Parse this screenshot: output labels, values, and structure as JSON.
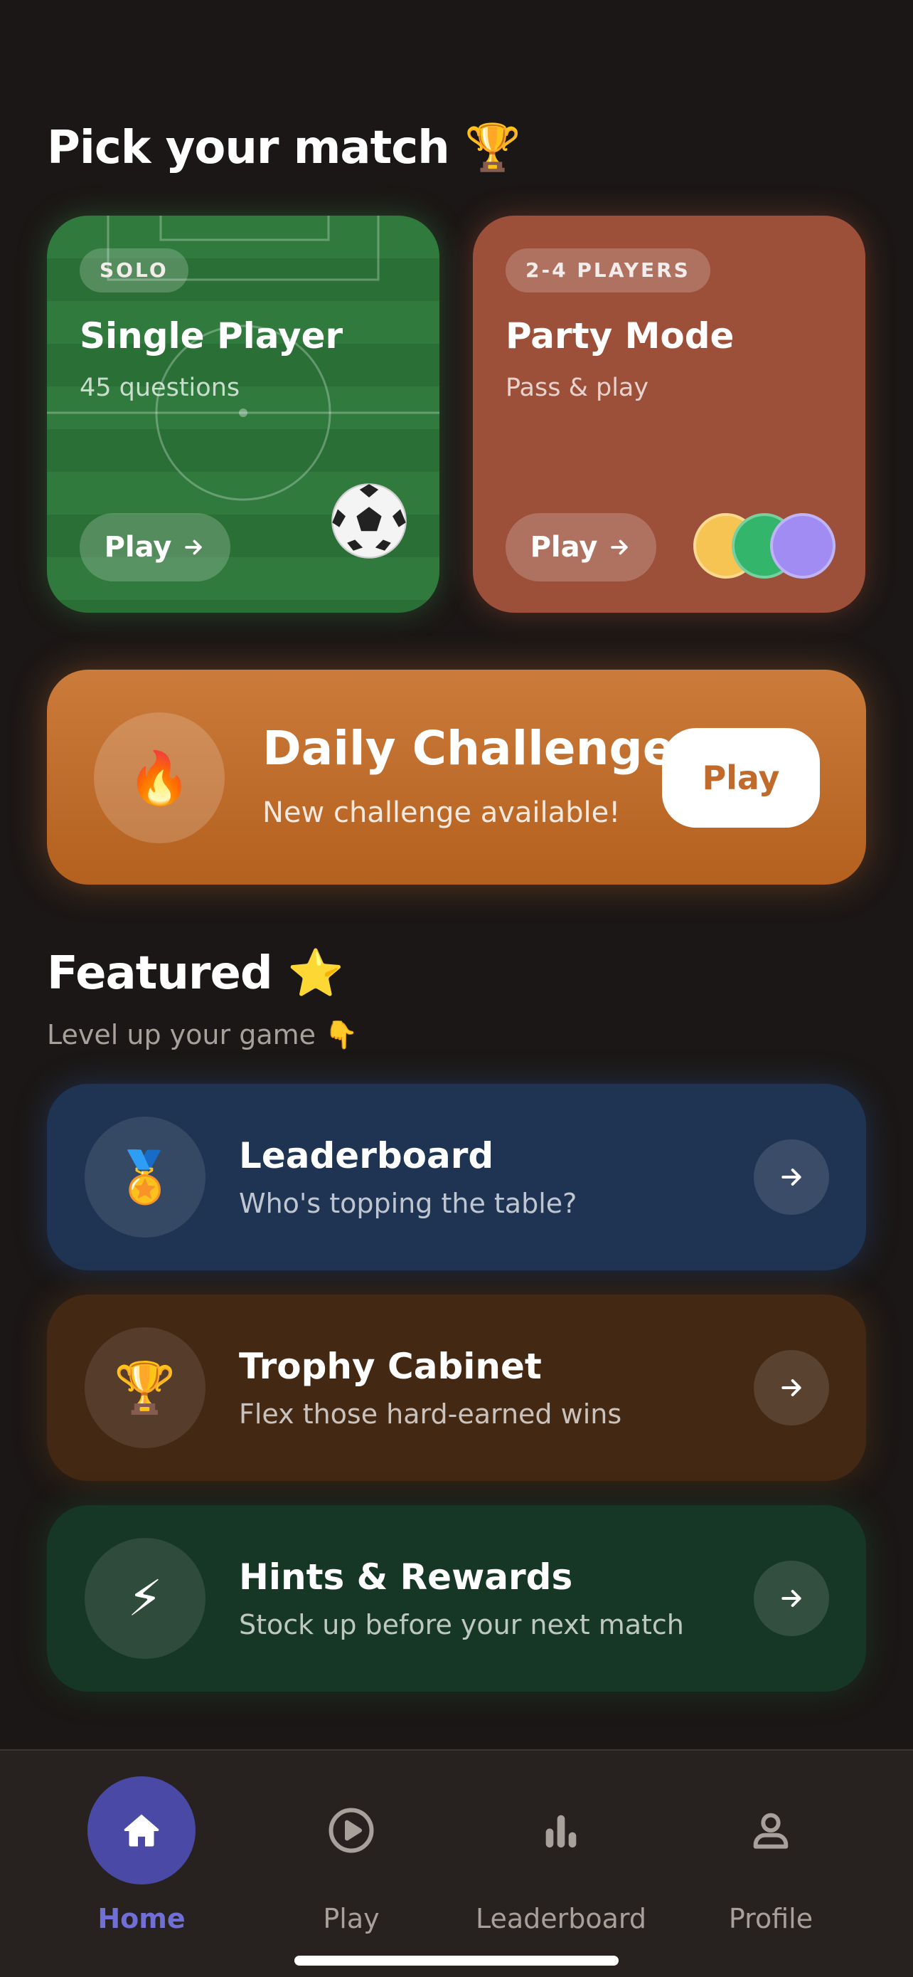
{
  "header": {
    "title": "Pick your match",
    "title_emoji": "🏆"
  },
  "modes": [
    {
      "badge": "SOLO",
      "title": "Single Player",
      "subtitle": "45 questions",
      "play_label": "Play",
      "decoration_emoji": "⚽",
      "color": "#2f7a3c"
    },
    {
      "badge": "2-4 PLAYERS",
      "title": "Party Mode",
      "subtitle": "Pass & play",
      "play_label": "Play",
      "avatar_colors": [
        "#f6c453",
        "#33b56b",
        "#a08cf2"
      ],
      "color": "#9c4f39"
    }
  ],
  "daily": {
    "title": "Daily Challenge",
    "subtitle": "New challenge available!",
    "play_label": "Play",
    "icon_emoji": "🔥",
    "color": "#c06a2b"
  },
  "featured": {
    "title": "Featured",
    "title_emoji": "⭐",
    "subtitle": "Level up your game 👇",
    "items": [
      {
        "title": "Leaderboard",
        "subtitle": "Who's topping the table?",
        "icon_emoji": "🏅",
        "color": "#1f3453"
      },
      {
        "title": "Trophy Cabinet",
        "subtitle": "Flex those hard-earned wins",
        "icon_emoji": "🏆",
        "color": "#432814"
      },
      {
        "title": "Hints & Rewards",
        "subtitle": "Stock up before your next match",
        "icon_emoji": "⚡",
        "color": "#173726"
      }
    ]
  },
  "nav": {
    "active": "home",
    "active_color": "#4a4aa6",
    "items": [
      {
        "label": "Home",
        "icon": "home-icon"
      },
      {
        "label": "Play",
        "icon": "play-circle-icon"
      },
      {
        "label": "Leaderboard",
        "icon": "bar-chart-icon"
      },
      {
        "label": "Profile",
        "icon": "user-icon"
      }
    ]
  }
}
